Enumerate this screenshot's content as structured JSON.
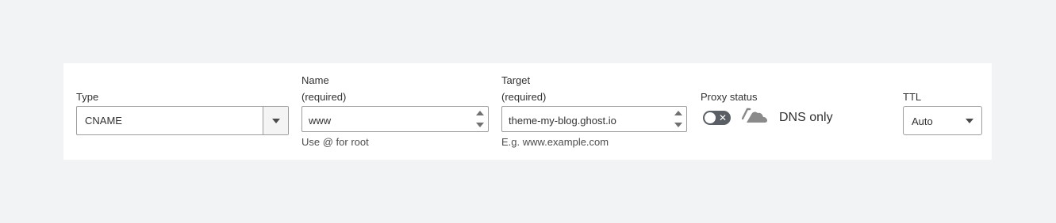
{
  "type_field": {
    "label": "Type",
    "value": "CNAME"
  },
  "name_field": {
    "label": "Name",
    "required": "(required)",
    "value": "www",
    "hint": "Use @ for root"
  },
  "target_field": {
    "label": "Target",
    "required": "(required)",
    "value": "theme-my-blog.ghost.io",
    "hint": "E.g. www.example.com"
  },
  "proxy_field": {
    "label": "Proxy status",
    "toggle_symbol": "✕",
    "status_text": "DNS only",
    "icon": "cloud-off-icon",
    "enabled": false
  },
  "ttl_field": {
    "label": "TTL",
    "value": "Auto"
  },
  "colors": {
    "background": "#f2f3f4",
    "panel": "#ffffff",
    "toggle_off": "#5a5f65",
    "cloud": "#8a8a8a"
  }
}
